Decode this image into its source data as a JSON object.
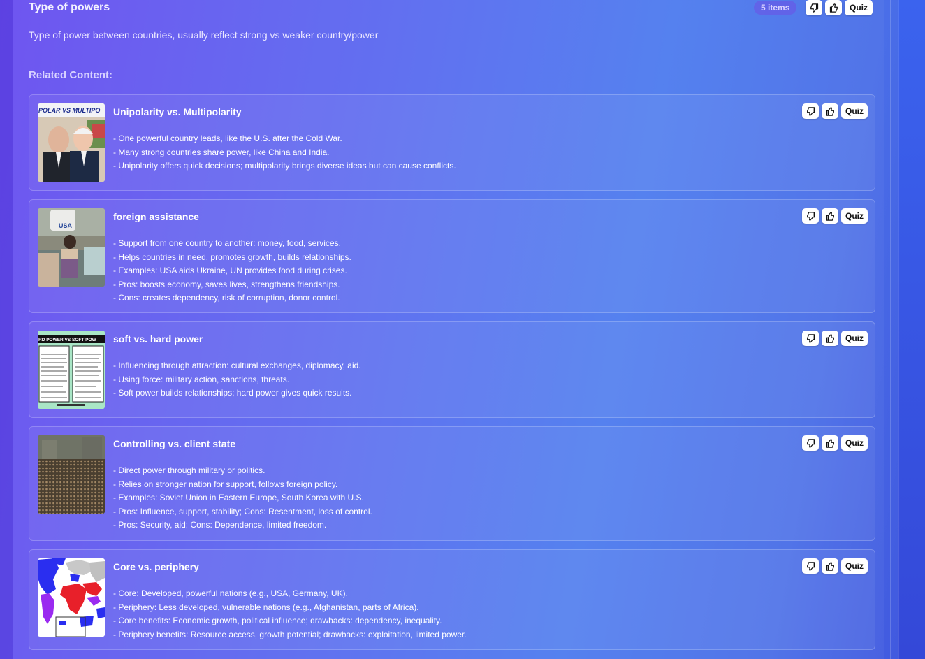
{
  "section": {
    "title": "Type of powers",
    "items_badge": "5 items",
    "quiz_label": "Quiz",
    "description": "Type of power between countries, usually reflect strong vs weaker country/power",
    "related_heading": "Related Content:"
  },
  "icons": {
    "dislike": "thumbs-down-icon",
    "like": "thumbs-up-icon"
  },
  "colors": {
    "background_start": "#6a4ff0",
    "background_end": "#3f55dd",
    "button_bg": "#ffffff",
    "badge_bg": "#6e50e6"
  },
  "cards": [
    {
      "title": "Unipolarity vs. Multipolarity",
      "quiz_label": "Quiz",
      "thumb_text": "POLAR VS MULTIPO",
      "bullets": [
        "- One powerful country leads, like the U.S. after the Cold War.",
        "- Many strong countries share power, like China and India.",
        "- Unipolarity offers quick decisions; multipolarity brings diverse ideas but can cause conflicts."
      ]
    },
    {
      "title": "foreign assistance",
      "quiz_label": "Quiz",
      "thumb_text": "USA",
      "bullets": [
        "- Support from one country to another: money, food, services.",
        "- Helps countries in need, promotes growth, builds relationships.",
        "- Examples: USA aids Ukraine, UN provides food during crises.",
        "- Pros: boosts economy, saves lives, strengthens friendships.",
        "- Cons: creates dependency, risk of corruption, donor control."
      ]
    },
    {
      "title": "soft vs. hard power",
      "quiz_label": "Quiz",
      "thumb_text": "RD POWER VS SOFT POW",
      "bullets": [
        "- Influencing through attraction: cultural exchanges, diplomacy, aid.",
        "- Using force: military action, sanctions, threats.",
        "- Soft power builds relationships; hard power gives quick results."
      ]
    },
    {
      "title": "Controlling vs. client state",
      "quiz_label": "Quiz",
      "bullets": [
        "- Direct power through military or politics.",
        "- Relies on stronger nation for support, follows foreign policy.",
        "- Examples: Soviet Union in Eastern Europe, South Korea with U.S.",
        "- Pros: Influence, support, stability; Cons: Resentment, loss of control.",
        "- Pros: Security, aid; Cons: Dependence, limited freedom."
      ]
    },
    {
      "title": "Core vs. periphery",
      "quiz_label": "Quiz",
      "bullets": [
        "- Core: Developed, powerful nations (e.g., USA, Germany, UK).",
        "- Periphery: Less developed, vulnerable nations (e.g., Afghanistan, parts of Africa).",
        "- Core benefits: Economic growth, political influence; drawbacks: dependency, inequality.",
        "- Periphery benefits: Resource access, growth potential; drawbacks: exploitation, limited power."
      ]
    }
  ]
}
